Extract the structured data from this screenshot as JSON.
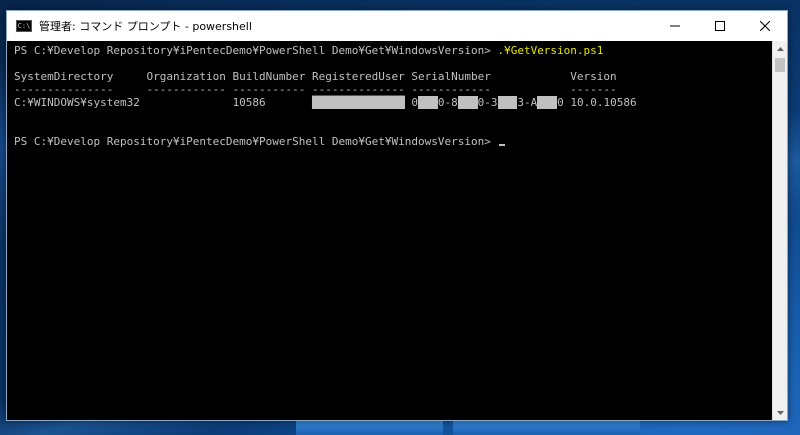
{
  "window": {
    "title": "管理者: コマンド プロンプト - powershell",
    "icon_label": "C:\\",
    "minimize_icon": "minimize-icon",
    "maximize_icon": "maximize-icon",
    "close_icon": "close-icon"
  },
  "console": {
    "prompt1": "PS C:¥Develop Repository¥iPentecDemo¥PowerShell Demo¥Get¥WindowsVersion> ",
    "command1": ".¥GetVersion.ps1",
    "header": "SystemDirectory     Organization BuildNumber RegisteredUser SerialNumber            Version",
    "underline": "---------------     ------------ ----------- -------------- ------------            -------",
    "row": {
      "system_directory": "C:¥WINDOWS¥system32",
      "build_number": "10586",
      "registered_user": "██████████████",
      "serial_part1": "0",
      "serial_part2": "0-8",
      "serial_part3": "0-3",
      "serial_part4": "3-A",
      "serial_part5": "0",
      "version": "10.0.10586"
    },
    "prompt2": "PS C:¥Develop Repository¥iPentecDemo¥PowerShell Demo¥Get¥WindowsVersion> "
  },
  "colors": {
    "console_bg": "#000000",
    "console_text": "#c0c0c0",
    "command_text": "#e6e600",
    "titlebar_bg": "#ffffff"
  }
}
